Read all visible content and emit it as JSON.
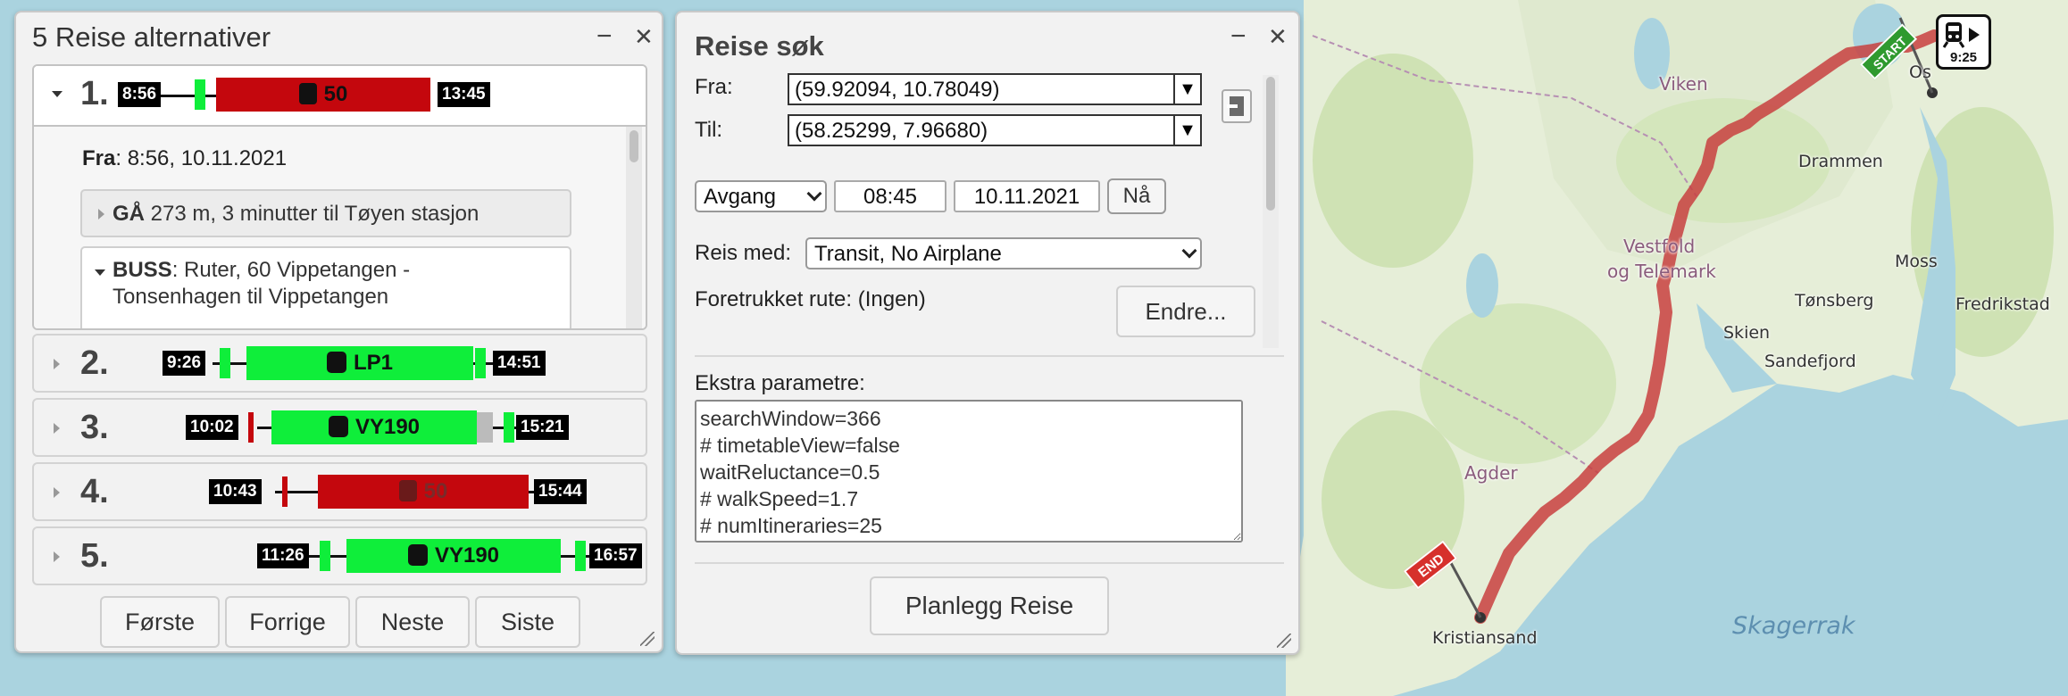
{
  "map": {
    "labels": {
      "oslo": "Os",
      "viken": "Viken",
      "drammen": "Drammen",
      "moss": "Moss",
      "fredrikstad": "Fredrikstad",
      "tonsberg": "Tønsberg",
      "sandefjord": "Sandefjord",
      "skien": "Skien",
      "vestfold": "Vestfold",
      "telemark": "og Telemark",
      "agder": "Agder",
      "kristiansand": "Kristiansand",
      "skagerrak": "Skagerrak"
    },
    "start_flag": "START",
    "end_flag": "END",
    "vehicle_time": "9:25",
    "route_color": "#c84040",
    "sea_color": "#aad3df",
    "land_color": "#e6eed8"
  },
  "list_panel": {
    "title": "5 Reise alternativer",
    "minimize": "−",
    "close": "✕",
    "itineraries": [
      {
        "num": "1.",
        "start": "8:56",
        "end": "13:45",
        "mode": "train-icon",
        "label": "50",
        "color": "red"
      },
      {
        "num": "2.",
        "start": "9:26",
        "end": "14:51",
        "mode": "bus-icon",
        "label": "LP1",
        "color": "green"
      },
      {
        "num": "3.",
        "start": "10:02",
        "end": "15:21",
        "mode": "bus-icon",
        "label": "VY190",
        "color": "green"
      },
      {
        "num": "4.",
        "start": "10:43",
        "end": "15:44",
        "mode": "train-icon",
        "label": "50",
        "color": "red"
      },
      {
        "num": "5.",
        "start": "11:26",
        "end": "16:57",
        "mode": "bus-icon",
        "label": "VY190",
        "color": "green"
      }
    ],
    "details": {
      "from_label": "Fra",
      "from_value": ": 8:56, 10.11.2021",
      "walk_mode": "GÅ",
      "walk_text": " 273 m, 3 minutter til Tøyen stasjon",
      "bus_mode": "BUSS",
      "bus_text_1": ": Ruter, 60 Vippetangen -",
      "bus_text_2": "Tonsenhagen til Vippetangen"
    },
    "buttons": {
      "first": "Første",
      "prev": "Forrige",
      "next": "Neste",
      "last": "Siste"
    }
  },
  "search_panel": {
    "title": "Reise søk",
    "minimize": "−",
    "close": "✕",
    "from_label": "Fra:",
    "from_value": "(59.92094, 10.78049)",
    "to_label": "Til:",
    "to_value": "(58.25299, 7.96680)",
    "depart_arrive": "Avgang",
    "time": "08:45",
    "date": "10.11.2021",
    "now_button": "Nå",
    "travel_with_label": "Reis med:",
    "travel_with_value": "Transit, No Airplane",
    "preferred_route": "Foretrukket rute: (Ingen)",
    "change_button": "Endre...",
    "extra_params_label": "Ekstra parametre:",
    "extra_params": "searchWindow=366\n# timetableView=false\nwaitReluctance=0.5\n# walkSpeed=1.7\n# numItineraries=25",
    "plan_button": "Planlegg Reise"
  }
}
